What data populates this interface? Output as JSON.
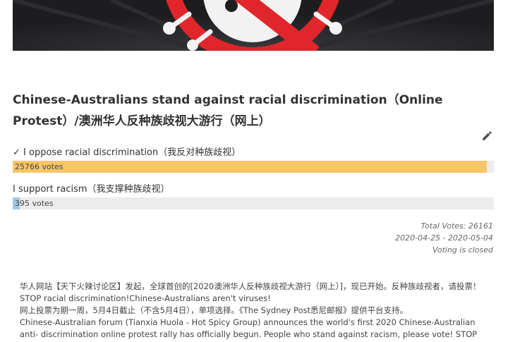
{
  "poll": {
    "title": "Chinese-Australians stand against racial discrimination（Online Protest）/澳洲华人反种族歧视大游行（网上）",
    "options": [
      {
        "label": "✓ I oppose racial discrimination（我反对种族歧视）",
        "votes_text": "25766 votes",
        "votes": 25766,
        "fraction": 0.985,
        "color": "#f9c566"
      },
      {
        "label": "I support racism（我支撑种族歧视）",
        "votes_text": "395 votes",
        "votes": 395,
        "fraction": 0.015,
        "color": "#9fc6e8"
      }
    ],
    "total_votes": "Total Votes: 26161",
    "date_range": "2020-04-25 - 2020-05-04",
    "status": "Voting is closed"
  },
  "description": {
    "lines": [
      "华人网站【天下火辣讨论区】发起，全球首创的[2020澳洲华人反种族歧视大游行（网上）]，现已开始。反种族歧视者，请投票！ STOP racial discrimination!Chinese-Australians aren't viruses!",
      "网上投票为期一周，5月4日截止（不含5月4日），单项选择。《The Sydney Post悉尼邮报》提供平台支持。",
      "Chinese-Australian forum (Tianxia Huola - Hot Spicy Group) announces the world's first 2020 Chinese-Australian anti- discrimination online protest rally has officially begun. People who stand against racism, please vote! STOP"
    ]
  },
  "icons": {
    "edit": "pencil-icon",
    "banner": "no-virus-icon"
  }
}
